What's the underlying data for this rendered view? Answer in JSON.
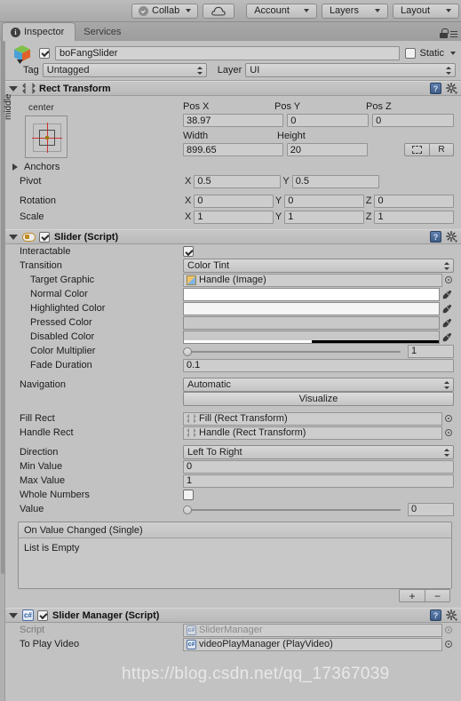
{
  "toolbar": {
    "collab_label": "Collab",
    "cloud_label": "cloud-icon",
    "account_label": "Account",
    "layers_label": "Layers",
    "layout_label": "Layout"
  },
  "tabs": [
    {
      "label": "Inspector",
      "active": true
    },
    {
      "label": "Services",
      "active": false
    }
  ],
  "gameobject": {
    "enabled": true,
    "name": "boFangSlider",
    "static_label": "Static",
    "static_checked": false,
    "tag_label": "Tag",
    "tag_value": "Untagged",
    "layer_label": "Layer",
    "layer_value": "UI"
  },
  "rect_transform": {
    "title": "Rect Transform",
    "anchor_preset_top": "center",
    "anchor_preset_left": "middle",
    "col_headers": [
      "Pos X",
      "Pos Y",
      "Pos Z"
    ],
    "pos_x": "38.97",
    "pos_y": "0",
    "pos_z": "0",
    "size_headers": [
      "Width",
      "Height"
    ],
    "width": "899.65",
    "height": "20",
    "blueprint_btn": "blueprint",
    "raw_btn": "R",
    "anchors_label": "Anchors",
    "pivot_label": "Pivot",
    "pivot_x": "0.5",
    "pivot_y": "0.5",
    "rotation_label": "Rotation",
    "rot_x": "0",
    "rot_y": "0",
    "rot_z": "0",
    "scale_label": "Scale",
    "scale_x": "1",
    "scale_y": "1",
    "scale_z": "1",
    "axis_x": "X",
    "axis_y": "Y",
    "axis_z": "Z"
  },
  "slider": {
    "title": "Slider (Script)",
    "enabled": true,
    "interactable_label": "Interactable",
    "interactable_checked": true,
    "transition_label": "Transition",
    "transition_value": "Color Tint",
    "target_graphic_label": "Target Graphic",
    "target_graphic_value": "Handle (Image)",
    "normal_color_label": "Normal Color",
    "normal_color_hex": "#ffffff",
    "highlighted_color_label": "Highlighted Color",
    "highlighted_color_hex": "#f5f5f5",
    "pressed_color_label": "Pressed Color",
    "pressed_color_hex": "#c8c8c8",
    "disabled_color_label": "Disabled Color",
    "disabled_color_hex": "#c8c8c8",
    "disabled_alpha_pct": "50",
    "color_multiplier_label": "Color Multiplier",
    "color_multiplier_value": "1",
    "fade_duration_label": "Fade Duration",
    "fade_duration_value": "0.1",
    "navigation_label": "Navigation",
    "navigation_value": "Automatic",
    "visualize_label": "Visualize",
    "fill_rect_label": "Fill Rect",
    "fill_rect_value": "Fill (Rect Transform)",
    "handle_rect_label": "Handle Rect",
    "handle_rect_value": "Handle (Rect Transform)",
    "direction_label": "Direction",
    "direction_value": "Left To Right",
    "min_value_label": "Min Value",
    "min_value": "0",
    "max_value_label": "Max Value",
    "max_value": "1",
    "whole_numbers_label": "Whole Numbers",
    "whole_numbers_checked": false,
    "value_label": "Value",
    "value": "0",
    "event_header": "On Value Changed (Single)",
    "event_empty": "List is Empty",
    "add_btn": "+",
    "remove_btn": "−"
  },
  "slider_manager": {
    "title": "Slider Manager (Script)",
    "enabled": true,
    "script_label": "Script",
    "script_value": "SliderManager",
    "to_play_video_label": "To Play Video",
    "to_play_video_value": "videoPlayManager (PlayVideo)"
  },
  "watermark": "https://blog.csdn.net/qq_17367039",
  "colors": {
    "window_bg": "#c2c2c2",
    "toolbar_bg": "#aeaeae",
    "field_bg": "#cdcdcd",
    "anchor_red": "#d2302f",
    "pivot_gold": "#9a7a10"
  }
}
